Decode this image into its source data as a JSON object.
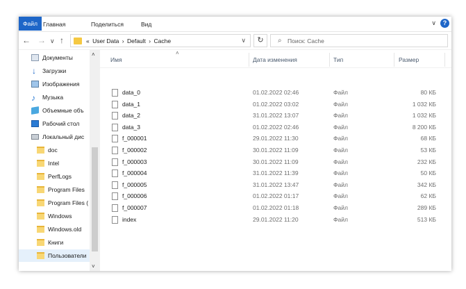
{
  "ribbon": {
    "tabs": [
      "Файл",
      "Главная",
      "Поделиться",
      "Вид"
    ],
    "help_glyph": "?",
    "collapse_glyph": "∨"
  },
  "nav": {
    "back": "←",
    "forward": "→",
    "recent": "∨",
    "up": "↑",
    "address_prefix": "«",
    "breadcrumbs": [
      "User Data",
      "Default",
      "Cache"
    ],
    "crumb_separator": "›",
    "dropdown": "∨",
    "refresh": "↻",
    "search_placeholder": "Поиск: Cache"
  },
  "sidebar": {
    "items": [
      {
        "label": "Документы",
        "icon": "documents-icon"
      },
      {
        "label": "Загрузки",
        "icon": "downloads-icon"
      },
      {
        "label": "Изображения",
        "icon": "pictures-icon"
      },
      {
        "label": "Музыка",
        "icon": "music-icon"
      },
      {
        "label": "Объемные объ",
        "icon": "3d-objects-icon"
      },
      {
        "label": "Рабочий стол",
        "icon": "desktop-icon"
      },
      {
        "label": "Локальный дис",
        "icon": "local-disk-icon"
      },
      {
        "label": "doc",
        "icon": "folder-icon"
      },
      {
        "label": "Intel",
        "icon": "folder-icon"
      },
      {
        "label": "PerfLogs",
        "icon": "folder-icon"
      },
      {
        "label": "Program Files",
        "icon": "folder-icon"
      },
      {
        "label": "Program Files (",
        "icon": "folder-icon"
      },
      {
        "label": "Windows",
        "icon": "folder-icon"
      },
      {
        "label": "Windows.old",
        "icon": "folder-icon"
      },
      {
        "label": "Книги",
        "icon": "folder-icon"
      },
      {
        "label": "Пользователи",
        "icon": "folder-icon",
        "selected": true
      }
    ],
    "scroll_up": "˄",
    "scroll_down": "˅"
  },
  "columns": {
    "name": "Имя",
    "date": "Дата изменения",
    "type": "Тип",
    "size": "Размер",
    "sort_indicator": "˄"
  },
  "files": [
    {
      "name": "data_0",
      "date": "01.02.2022 02:46",
      "type": "Файл",
      "size": "80 КБ"
    },
    {
      "name": "data_1",
      "date": "01.02.2022 03:02",
      "type": "Файл",
      "size": "1 032 КБ"
    },
    {
      "name": "data_2",
      "date": "31.01.2022 13:07",
      "type": "Файл",
      "size": "1 032 КБ"
    },
    {
      "name": "data_3",
      "date": "01.02.2022 02:46",
      "type": "Файл",
      "size": "8 200 КБ"
    },
    {
      "name": "f_000001",
      "date": "29.01.2022 11:30",
      "type": "Файл",
      "size": "68 КБ"
    },
    {
      "name": "f_000002",
      "date": "30.01.2022 11:09",
      "type": "Файл",
      "size": "53 КБ"
    },
    {
      "name": "f_000003",
      "date": "30.01.2022 11:09",
      "type": "Файл",
      "size": "232 КБ"
    },
    {
      "name": "f_000004",
      "date": "31.01.2022 11:39",
      "type": "Файл",
      "size": "50 КБ"
    },
    {
      "name": "f_000005",
      "date": "31.01.2022 13:47",
      "type": "Файл",
      "size": "342 КБ"
    },
    {
      "name": "f_000006",
      "date": "01.02.2022 01:17",
      "type": "Файл",
      "size": "62 КБ"
    },
    {
      "name": "f_000007",
      "date": "01.02.2022 01:18",
      "type": "Файл",
      "size": "289 КБ"
    },
    {
      "name": "index",
      "date": "29.01.2022 11:20",
      "type": "Файл",
      "size": "513 КБ"
    }
  ],
  "colors": {
    "accent": "#1e66c8",
    "folder": "#f8d775",
    "selected_bg": "#e5f0fb"
  }
}
